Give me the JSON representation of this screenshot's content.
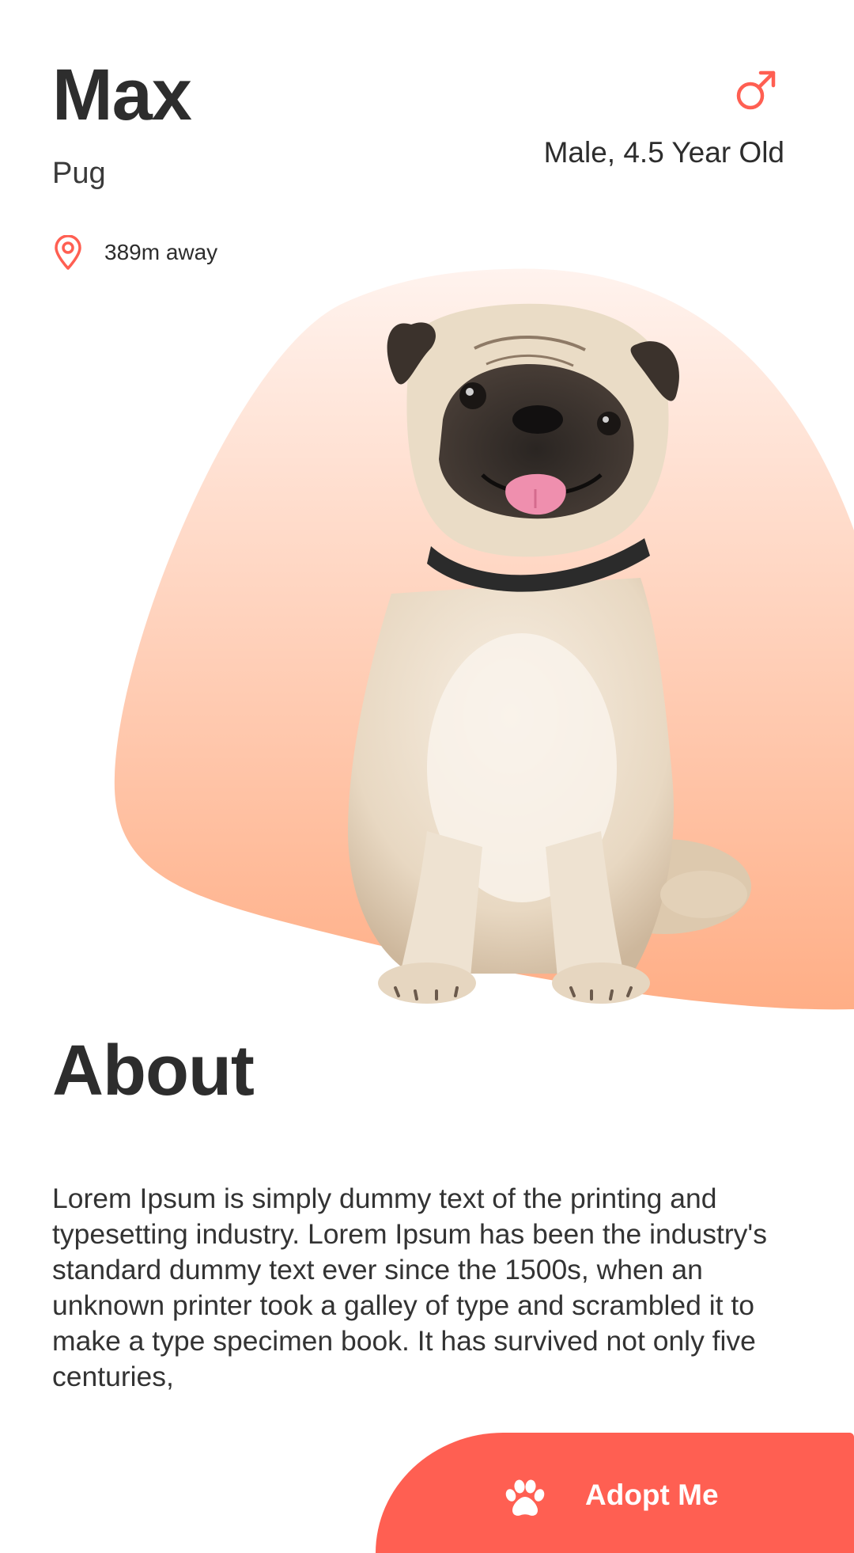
{
  "pet": {
    "name": "Max",
    "breed": "Pug",
    "gender_icon": "male-icon",
    "gender_age": "Male, 4.5 Year Old",
    "location_icon": "location-pin-icon",
    "distance": "389m away",
    "photo": "pug-photo"
  },
  "about": {
    "title": "About",
    "body": "Lorem Ipsum is simply dummy text of the printing and typesetting industry. Lorem Ipsum has been the industry's standard dummy text ever since the 1500s, when an unknown printer took a galley of type and scrambled it to make a type specimen book. It has survived not only five centuries,"
  },
  "cta": {
    "label": "Adopt Me",
    "icon": "paw-icon"
  },
  "colors": {
    "accent": "#ff5f52",
    "blob_top": "#fff0ea",
    "blob_bottom": "#ffb38c",
    "text": "#2d2d2d"
  }
}
